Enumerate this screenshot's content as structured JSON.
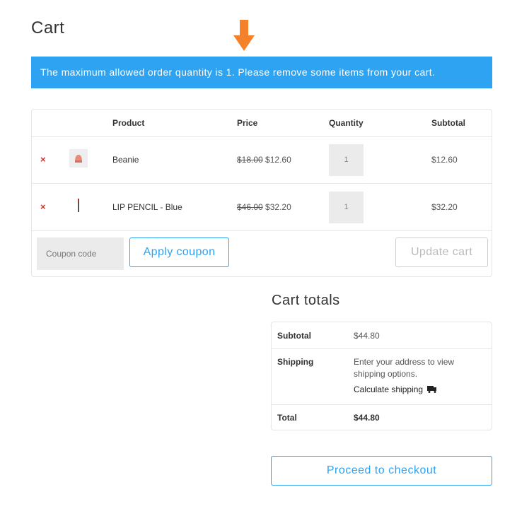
{
  "page": {
    "title": "Cart"
  },
  "notice": {
    "text": "The maximum allowed order quantity is 1. Please remove some items from your cart.",
    "color": "#2ea3f2"
  },
  "arrow": {
    "icon": "arrow-down-icon",
    "color": "#f5812a"
  },
  "table": {
    "headers": {
      "product": "Product",
      "price": "Price",
      "quantity": "Quantity",
      "subtotal": "Subtotal"
    },
    "items": [
      {
        "remove": "×",
        "name": "Beanie",
        "regular_price": "$18.00",
        "sale_price": "$12.60",
        "quantity": "1",
        "subtotal": "$12.60",
        "thumb_icon": "beanie-thumbnail"
      },
      {
        "remove": "×",
        "name": "LIP PENCIL - Blue",
        "regular_price": "$46.00",
        "sale_price": "$32.20",
        "quantity": "1",
        "subtotal": "$32.20",
        "thumb_icon": "lip-pencil-thumbnail"
      }
    ],
    "coupon_placeholder": "Coupon code",
    "apply_label": "Apply coupon",
    "update_label": "Update cart"
  },
  "totals": {
    "title": "Cart totals",
    "subtotal_label": "Subtotal",
    "subtotal_value": "$44.80",
    "shipping_label": "Shipping",
    "shipping_text": "Enter your address to view shipping options.",
    "calc_label": "Calculate shipping",
    "total_label": "Total",
    "total_value": "$44.80"
  },
  "checkout": {
    "label": "Proceed to checkout"
  },
  "colors": {
    "accent": "#2ea3f2",
    "remove": "#d9302c"
  }
}
